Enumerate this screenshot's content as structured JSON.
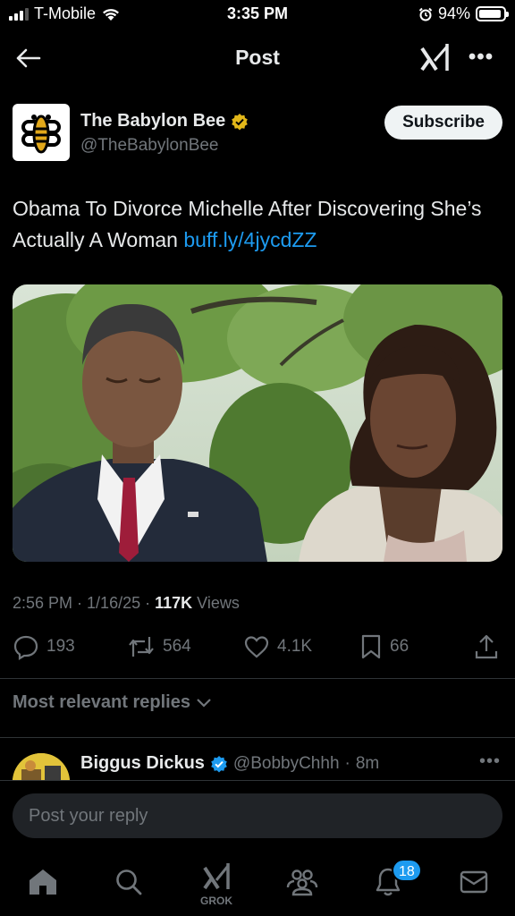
{
  "status_bar": {
    "carrier": "T-Mobile",
    "time": "3:35 PM",
    "battery": "94%",
    "battery_level": 0.94,
    "icons": [
      "signal-icon",
      "wifi-icon",
      "alarm-icon",
      "battery-icon"
    ]
  },
  "header": {
    "title": "Post",
    "icons": [
      "back-arrow-icon",
      "grok-icon",
      "more-icon"
    ]
  },
  "author": {
    "name": "The Babylon Bee",
    "handle": "@TheBabylonBee",
    "verified_color": "#e2b719",
    "subscribe_label": "Subscribe"
  },
  "post": {
    "text": "Obama To Divorce Michelle After Discovering She’s Actually A Woman",
    "link": "buff.ly/4jycdZZ",
    "time": "2:56 PM",
    "date": "1/16/25",
    "views_count": "117K",
    "views_label": "Views"
  },
  "actions": {
    "replies": "193",
    "reposts": "564",
    "likes": "4.1K",
    "bookmarks": "66",
    "icons": [
      "reply-icon",
      "repost-icon",
      "like-icon",
      "bookmark-icon",
      "share-icon"
    ]
  },
  "replies_filter": {
    "label": "Most relevant replies"
  },
  "reply_preview": {
    "name": "Biggus Dickus",
    "handle": "@BobbyChhh",
    "age": "8m",
    "verified_color": "#1d9bf0"
  },
  "composer": {
    "placeholder": "Post your reply"
  },
  "bottom_nav": {
    "grok_label": "GROK",
    "notification_count": "18",
    "items": [
      "home-icon",
      "search-icon",
      "grok-icon",
      "communities-icon",
      "notifications-icon",
      "messages-icon"
    ]
  },
  "colors": {
    "background": "#000000",
    "accent": "#1d9bf0",
    "muted": "#71767b"
  }
}
